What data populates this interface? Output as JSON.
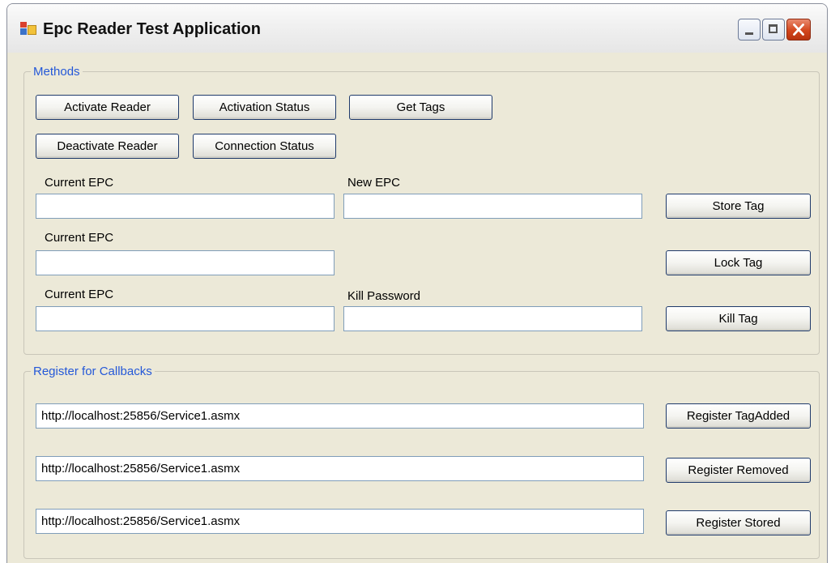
{
  "window": {
    "title": "Epc Reader Test Application"
  },
  "methods": {
    "legend": "Methods",
    "activate_reader": "Activate Reader",
    "activation_status": "Activation Status",
    "get_tags": "Get Tags",
    "deactivate_reader": "Deactivate Reader",
    "connection_status": "Connection Status",
    "store": {
      "current_epc_label": "Current EPC",
      "current_epc_value": "",
      "new_epc_label": "New EPC",
      "new_epc_value": "",
      "button": "Store Tag"
    },
    "lock": {
      "current_epc_label": "Current EPC",
      "current_epc_value": "",
      "button": "Lock Tag"
    },
    "kill": {
      "current_epc_label": "Current EPC",
      "current_epc_value": "",
      "kill_password_label": "Kill Password",
      "kill_password_value": "",
      "button": "Kill Tag"
    }
  },
  "callbacks": {
    "legend": "Register for Callbacks",
    "tag_added": {
      "url": "http://localhost:25856/Service1.asmx",
      "button": "Register TagAdded"
    },
    "removed": {
      "url": "http://localhost:25856/Service1.asmx",
      "button": "Register Removed"
    },
    "stored": {
      "url": "http://localhost:25856/Service1.asmx",
      "button": "Register Stored"
    }
  },
  "icons": {
    "app": "app-window-icon",
    "minimize": "minimize-icon",
    "maximize": "maximize-icon",
    "close": "close-icon"
  },
  "colors": {
    "legend_text": "#2458d8",
    "close_button": "#d3461d",
    "window_bg": "#ece9d8"
  }
}
